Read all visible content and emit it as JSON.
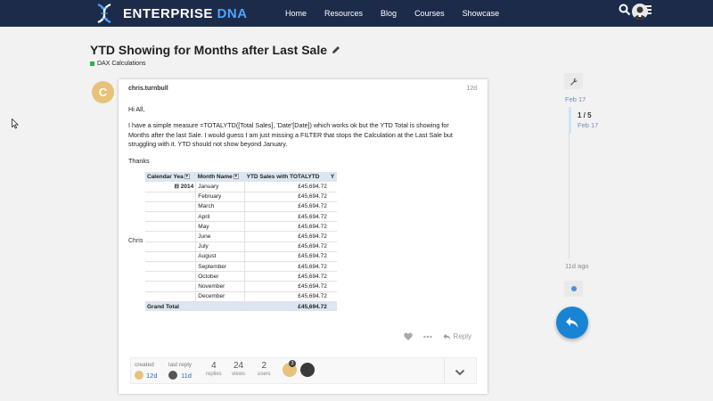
{
  "header": {
    "brand_primary": "ENTERPRISE",
    "brand_secondary": "DNA",
    "nav": [
      "Home",
      "Resources",
      "Blog",
      "Courses",
      "Showcase"
    ],
    "icons": [
      "search-icon",
      "menu-icon",
      "user-avatar"
    ]
  },
  "topic": {
    "title": "YTD Showing for Months after Last Sale",
    "category": "DAX Calculations",
    "category_color": "#2bb24c"
  },
  "post": {
    "avatar_letter": "C",
    "username": "chris.turnbull",
    "date": "12d",
    "greeting": "Hi All,",
    "paragraph": "I have a simple measure =TOTALYTD([Total Sales], 'Date'[Date]) which works ok but the YTD Total is showing for Months after the last Sale. I would guess I am just missing a FILTER that stops the Calculation at the Last Sale but struggling with it. YTD should not show beyond January.",
    "thanks": "Thanks",
    "signature": "Chris",
    "table": {
      "headers": [
        "Calendar Yea",
        "Month Name",
        "YTD Sales with TOTALYTD",
        "Y"
      ],
      "year": "2014",
      "rows": [
        {
          "month": "January",
          "value": "£45,694.72"
        },
        {
          "month": "February",
          "value": "£45,694.72"
        },
        {
          "month": "March",
          "value": "£45,694.72"
        },
        {
          "month": "April",
          "value": "£45,694.72"
        },
        {
          "month": "May",
          "value": "£45,694.72"
        },
        {
          "month": "June",
          "value": "£45,694.72"
        },
        {
          "month": "July",
          "value": "£45,694.72"
        },
        {
          "month": "August",
          "value": "£45,694.72"
        },
        {
          "month": "September",
          "value": "£45,694.72"
        },
        {
          "month": "October",
          "value": "£45,694.72"
        },
        {
          "month": "November",
          "value": "£45,694.72"
        },
        {
          "month": "December",
          "value": "£45,694.72"
        }
      ],
      "total_label": "Grand Total",
      "total_value": "£45,694.72"
    },
    "actions": {
      "reply_label": "Reply"
    }
  },
  "topic_map": {
    "created_label": "created",
    "created_value": "12d",
    "last_reply_label": "last reply",
    "last_reply_value": "11d",
    "replies_count": "4",
    "replies_label": "replies",
    "views_count": "24",
    "views_label": "views",
    "users_count": "2",
    "users_label": "users",
    "participant_badge": "3"
  },
  "timeline": {
    "start_date": "Feb 17",
    "counter": "1 / 5",
    "counter_date": "Feb 17",
    "ago": "11d ago"
  },
  "colors": {
    "header_bg": "#1c2b4a",
    "accent_blue": "#1a84d4",
    "table_header_bg": "#dce6f1"
  }
}
